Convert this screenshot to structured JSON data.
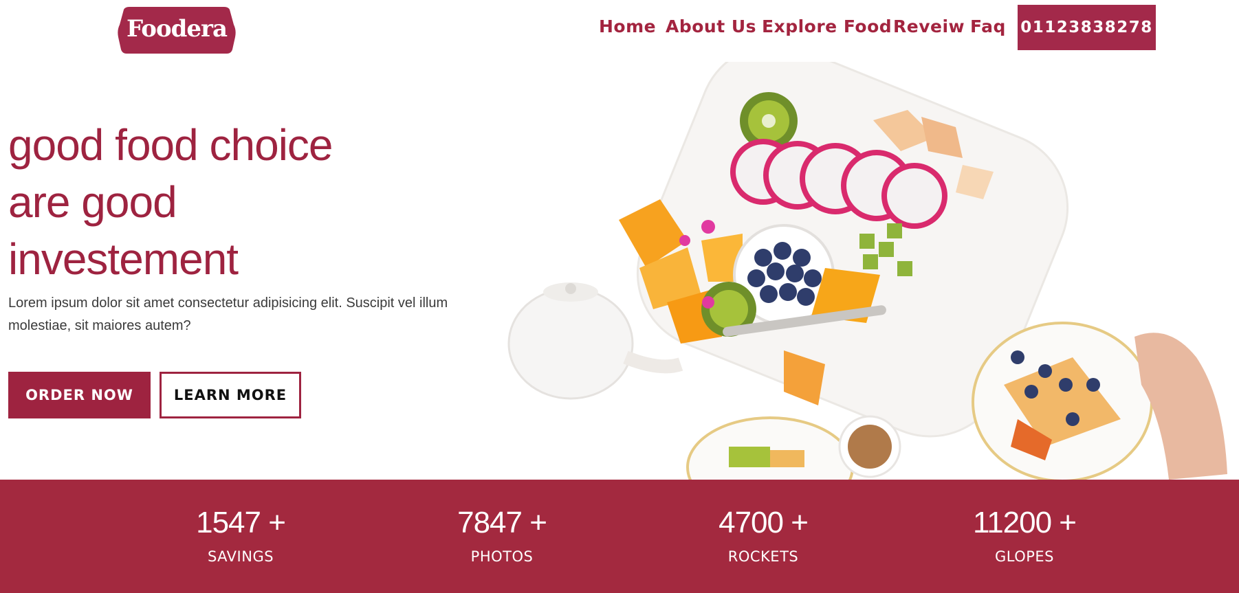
{
  "brand": {
    "logo_text": "Foodera",
    "color": "#a3243f"
  },
  "nav": {
    "items": [
      {
        "label": "Home"
      },
      {
        "label": "About Us"
      },
      {
        "label": "Explore Food"
      },
      {
        "label": "Reveiw"
      },
      {
        "label": "Faq"
      }
    ],
    "phone": "01123838278"
  },
  "hero": {
    "title_lines": [
      "good food choice",
      "are good",
      "investement"
    ],
    "description": "Lorem ipsum dolor sit amet consectetur adipisicing elit. Suscipit vel illum molestiae, sit maiores autem?",
    "order_button": "ORDER NOW",
    "learn_button": "LEARN MORE"
  },
  "stats": [
    {
      "value": "1547 +",
      "label": "SAVINGS"
    },
    {
      "value": "7847 +",
      "label": "PHOTOS"
    },
    {
      "value": "4700 +",
      "label": "ROCKETS"
    },
    {
      "value": "11200 +",
      "label": "GLOPES"
    }
  ],
  "colors": {
    "accent": "#a3243f",
    "stats_bg": "#a3293f",
    "text": "#3a3a3a"
  }
}
